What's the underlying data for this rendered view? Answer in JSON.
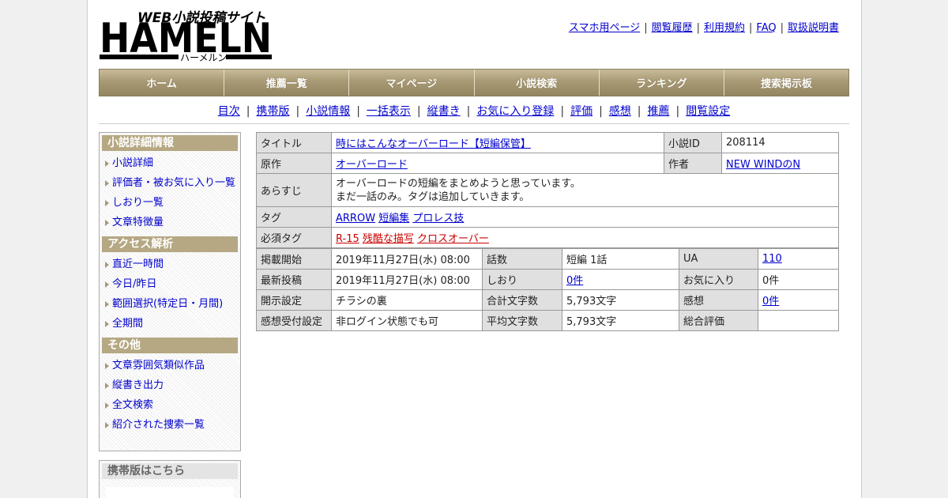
{
  "logo": {
    "tagline": "WEB小説投稿サイト",
    "wordmark": "HAMELN",
    "kana": "ハーメルン"
  },
  "toplinks": [
    "スマホ用ページ",
    "閲覧履歴",
    "利用規約",
    "FAQ",
    "取扱説明書"
  ],
  "mainnav": [
    "ホーム",
    "推薦一覧",
    "マイページ",
    "小説検索",
    "ランキング",
    "捜索掲示板"
  ],
  "subnav": [
    "目次",
    "携帯版",
    "小説情報",
    "一括表示",
    "縦書き",
    "お気に入り登録",
    "評価",
    "感想",
    "推薦",
    "閲覧設定"
  ],
  "sidebar": {
    "sections": [
      {
        "title": "小説詳細情報",
        "items": [
          "小説詳細",
          "評価者・被お気に入り一覧",
          "しおり一覧",
          "文章特徴量"
        ]
      },
      {
        "title": "アクセス解析",
        "items": [
          "直近一時間",
          "今日/昨日",
          "範囲選択(特定日・月間)",
          "全期間"
        ]
      },
      {
        "title": "その他",
        "items": [
          "文章雰囲気類似作品",
          "縦書き出力",
          "全文検索",
          "紹介された捜索一覧"
        ]
      }
    ],
    "mobile_title": "携帯版はこちら"
  },
  "info": {
    "title_label": "タイトル",
    "title": "時にはこんなオーバーロード【短編保管】",
    "id_label": "小説ID",
    "id": "208114",
    "original_label": "原作",
    "original": "オーバーロード",
    "author_label": "作者",
    "author": "NEW WINDのN",
    "synopsis_label": "あらすじ",
    "synopsis_line1": "オーバーロードの短編をまとめようと思っています。",
    "synopsis_line2": "まだ一話のみ。タグは追加していきます。",
    "tags_label": "タグ",
    "tags": [
      "ARROW",
      "短編集",
      "プロレス技"
    ],
    "req_tags_label": "必須タグ",
    "req_tags": [
      "R-15",
      "残酷な描写",
      "クロスオーバー"
    ]
  },
  "stats": {
    "rows": [
      [
        {
          "l": "掲載開始",
          "v": "2019年11月27日(水) 08:00"
        },
        {
          "l": "話数",
          "v": "短編 1話"
        },
        {
          "l": "UA",
          "v": "110",
          "link": true
        }
      ],
      [
        {
          "l": "最新投稿",
          "v": "2019年11月27日(水) 08:00"
        },
        {
          "l": "しおり",
          "v": "0件",
          "link": true
        },
        {
          "l": "お気に入り",
          "v": "0件"
        }
      ],
      [
        {
          "l": "開示設定",
          "v": "チラシの裏"
        },
        {
          "l": "合計文字数",
          "v": "5,793文字"
        },
        {
          "l": "感想",
          "v": "0件",
          "link": true
        }
      ],
      [
        {
          "l": "感想受付設定",
          "v": "非ログイン状態でも可"
        },
        {
          "l": "平均文字数",
          "v": "5,793文字"
        },
        {
          "l": "総合評価",
          "v": ""
        }
      ]
    ]
  }
}
